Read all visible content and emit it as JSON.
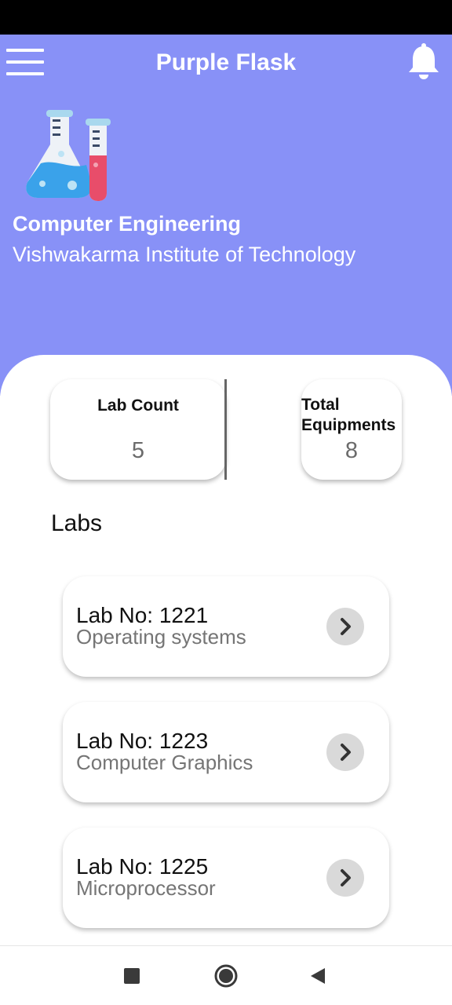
{
  "app": {
    "title": "Purple Flask",
    "header_color": "#8891f7"
  },
  "icons": {
    "menu": "hamburger-menu-icon",
    "notifications": "bell-icon",
    "logo": "flask-test-tube-icon",
    "lab_open": "chevron-right-icon",
    "nav_recents": "square-icon",
    "nav_home": "circle-icon",
    "nav_back": "triangle-back-icon"
  },
  "department": {
    "name": "Computer Engineering",
    "institute": "Vishwakarma Institute of Technology"
  },
  "stats": {
    "lab_count_label": "Lab Count",
    "lab_count_value": "5",
    "equipment_label_line1": "Total",
    "equipment_label_line2": "Equipments",
    "equipment_value": "8"
  },
  "labs_section": {
    "title": "Labs",
    "items": [
      {
        "number": "Lab No: 1221",
        "subject": "Operating systems"
      },
      {
        "number": "Lab No: 1223",
        "subject": "Computer Graphics"
      },
      {
        "number": "Lab No: 1225",
        "subject": "Microprocessor"
      }
    ]
  }
}
